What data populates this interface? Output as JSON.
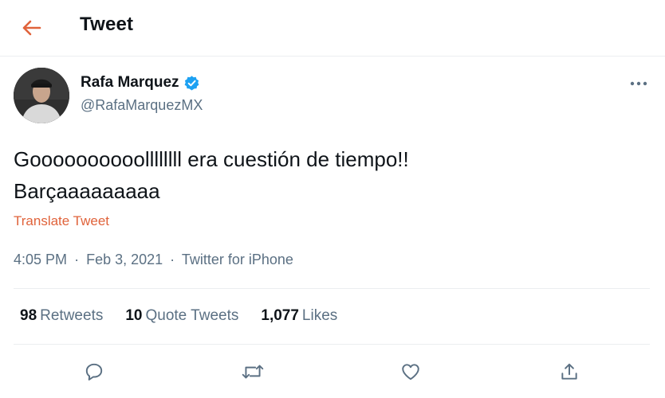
{
  "header": {
    "title": "Tweet",
    "back_icon": "arrow-left-icon",
    "accent_color": "#e0633b"
  },
  "author": {
    "name": "Rafa Marquez",
    "handle": "@RafaMarquezMX",
    "verified": true,
    "verified_icon": "verified-badge-icon",
    "verified_color": "#1da1f2"
  },
  "tweet": {
    "text_line1": "Goooooooooollllllll era cuestión de tiempo!!",
    "text_line2": "Barçaaaaaaaaa",
    "translate_label": "Translate Tweet",
    "time": "4:05 PM",
    "separator": "·",
    "date": "Feb 3, 2021",
    "source": "Twitter for iPhone"
  },
  "stats": {
    "retweets_count": "98",
    "retweets_label": "Retweets",
    "quotes_count": "10",
    "quotes_label": "Quote Tweets",
    "likes_count": "1,077",
    "likes_label": "Likes"
  },
  "actions": [
    "reply-icon",
    "retweet-icon",
    "like-icon",
    "share-icon"
  ]
}
